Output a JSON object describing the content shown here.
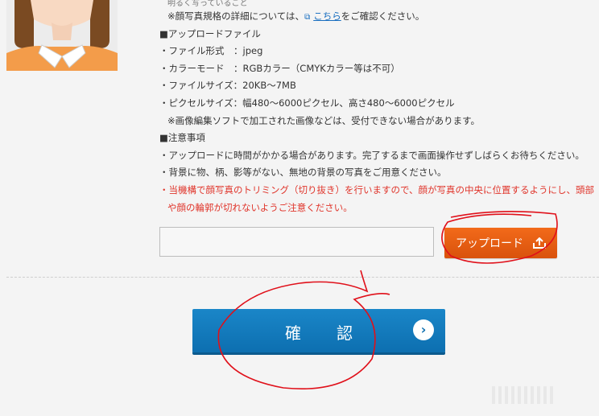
{
  "partial_top_line": "明るく写っていること",
  "lines": [
    {
      "id": "spec-note",
      "text": "※顔写真規格の詳細については、",
      "link": "こちら",
      "after": "をご確認ください。",
      "indent": true
    },
    {
      "id": "upload-file-heading",
      "text": "■アップロードファイル"
    },
    {
      "id": "file-format",
      "text": "・ファイル形式　：jpeg"
    },
    {
      "id": "color-mode",
      "text": "・カラーモード　：RGBカラー（CMYKカラー等は不可）"
    },
    {
      "id": "file-size",
      "text": "・ファイルサイズ：20KB〜7MB"
    },
    {
      "id": "pixel-size",
      "text": "・ピクセルサイズ：幅480〜6000ピクセル、高さ480〜6000ピクセル"
    },
    {
      "id": "edited-note",
      "text": "※画像編集ソフトで加工された画像などは、受付できない場合があります。",
      "indent": true
    },
    {
      "id": "notes-heading",
      "text": "■注意事項"
    },
    {
      "id": "upload-time-note",
      "text": "・アップロードに時間がかかる場合があります。完了するまで画面操作せずしばらくお待ちください。"
    },
    {
      "id": "background-note",
      "text": "・背景に物、柄、影等がない、無地の背景の写真をご用意ください。"
    },
    {
      "id": "trim-note-1",
      "text": "・当機構で顔写真のトリミング（切り抜き）を行いますので、顔が写真の中央に位置するようにし、頭部",
      "red": true
    },
    {
      "id": "trim-note-2",
      "text": "や顔の輪郭が切れないようご注意ください。",
      "red": true,
      "indent": true
    }
  ],
  "upload": {
    "button_label": "アップロード",
    "icon": "upload-icon"
  },
  "confirm": {
    "button_label": "確　認",
    "icon": "chevron-right-circle-icon"
  },
  "colors": {
    "upload_button": "#e85f12",
    "confirm_button": "#1479bc",
    "annotation": "#e0101a",
    "note_red": "#e0352b"
  }
}
